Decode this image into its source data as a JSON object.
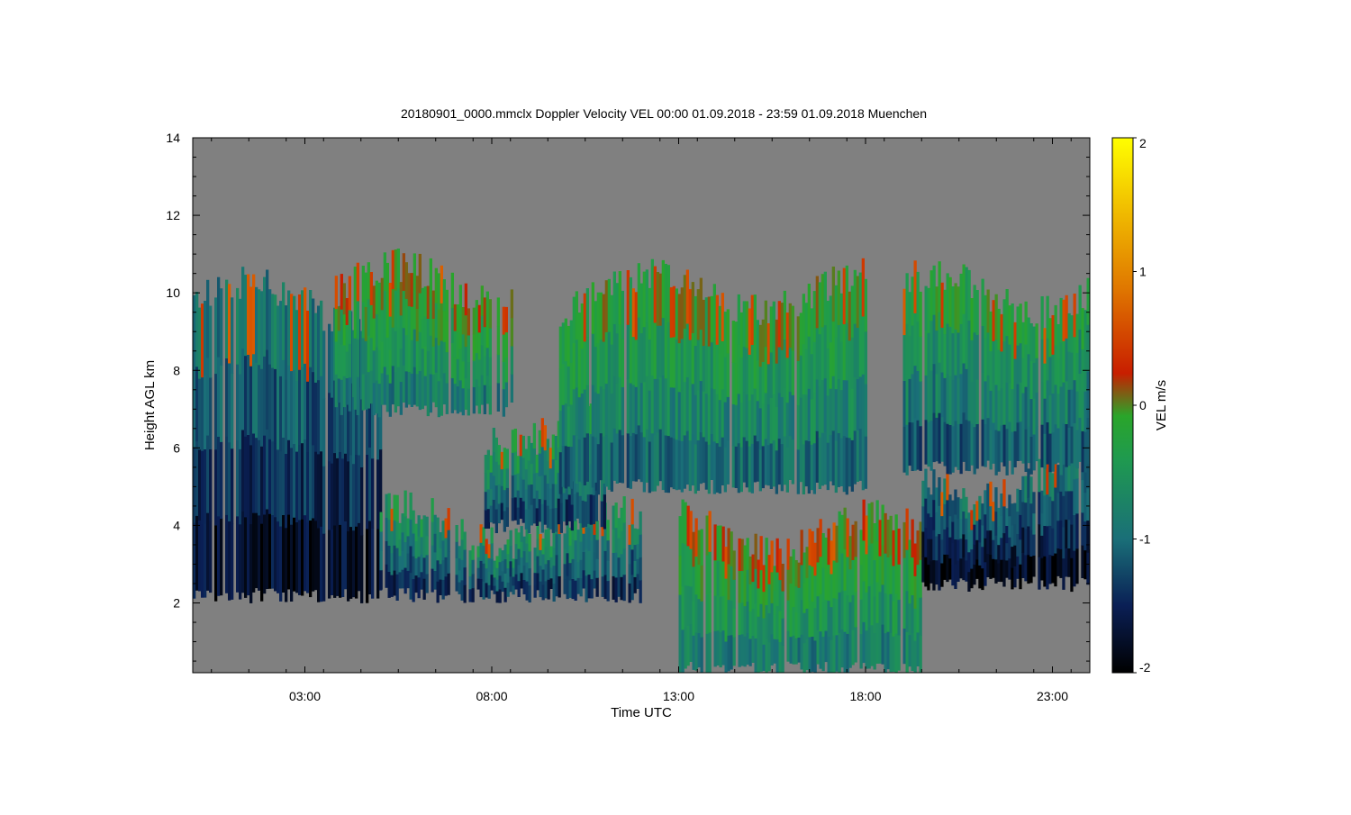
{
  "chart_data": {
    "type": "heatmap",
    "title": "20180901_0000.mmclx Doppler Velocity VEL   00:00 01.09.2018 - 23:59 01.09.2018 Muenchen",
    "xlabel": "Time UTC",
    "ylabel": "Height AGL km",
    "colorbar_label": "VEL m/s",
    "xlim": [
      0,
      24
    ],
    "ylim": [
      0.2,
      14
    ],
    "x_ticks": [
      {
        "value": 3,
        "label": "03:00"
      },
      {
        "value": 8,
        "label": "08:00"
      },
      {
        "value": 13,
        "label": "13:00"
      },
      {
        "value": 18,
        "label": "18:00"
      },
      {
        "value": 23,
        "label": "23:00"
      }
    ],
    "y_ticks": [
      {
        "value": 2,
        "label": "2"
      },
      {
        "value": 4,
        "label": "4"
      },
      {
        "value": 6,
        "label": "6"
      },
      {
        "value": 8,
        "label": "8"
      },
      {
        "value": 10,
        "label": "10"
      },
      {
        "value": 12,
        "label": "12"
      },
      {
        "value": 14,
        "label": "14"
      }
    ],
    "colorbar_range": [
      -2,
      2
    ],
    "colorbar_ticks": [
      {
        "value": 2,
        "label": "2"
      },
      {
        "value": 1,
        "label": "1"
      },
      {
        "value": 0,
        "label": "0"
      },
      {
        "value": -1,
        "label": "-1"
      },
      {
        "value": -2,
        "label": "-2"
      }
    ],
    "colormap": [
      "#000000",
      "#0a1f55",
      "#1a6f78",
      "#1f9a4f",
      "#2aa52a",
      "#c81e00",
      "#e07800",
      "#f2c400",
      "#ffff00"
    ],
    "background_color": "#808080",
    "echo_regions": [
      {
        "t0": 0.0,
        "t1": 5.0,
        "h0": 2.2,
        "h1": 9.8,
        "vel": -1.2
      },
      {
        "t0": 5.0,
        "t1": 12.0,
        "h0": 2.2,
        "h1": 4.0,
        "vel": -0.9
      },
      {
        "t0": 13.0,
        "t1": 19.5,
        "h0": 0.3,
        "h1": 3.8,
        "vel": -0.3
      },
      {
        "t0": 19.5,
        "t1": 24.0,
        "h0": 2.5,
        "h1": 5.2,
        "vel": -1.3
      },
      {
        "t0": 7.8,
        "t1": 11.0,
        "h0": 4.0,
        "h1": 6.6,
        "vel": -0.8
      },
      {
        "t0": 9.8,
        "t1": 18.0,
        "h0": 5.0,
        "h1": 10.0,
        "vel": -0.5
      },
      {
        "t0": 3.8,
        "t1": 8.5,
        "h0": 7.0,
        "h1": 10.2,
        "vel": -0.3
      },
      {
        "t0": 19.0,
        "t1": 24.0,
        "h0": 5.5,
        "h1": 10.0,
        "vel": -0.6
      }
    ]
  }
}
